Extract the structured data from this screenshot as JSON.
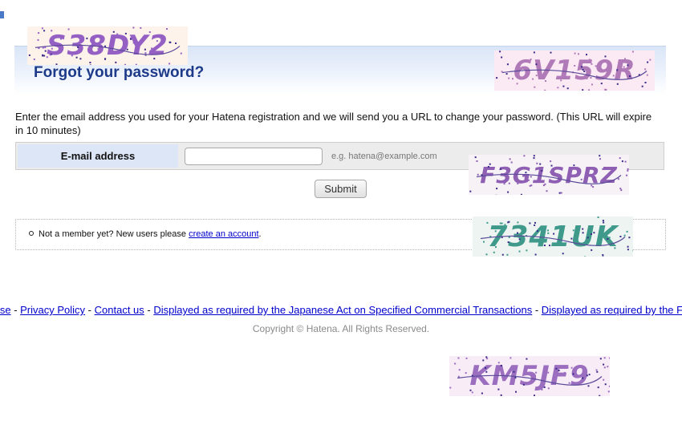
{
  "header": {
    "title": "Forgot your password?"
  },
  "intro_text": "Enter the email address you used for your Hatena registration and we will send you a URL to change your password. (This URL will expire in 10 minutes)",
  "form": {
    "email_label": "E-mail address",
    "email_value": "",
    "email_hint": "e.g. hatena@example.com",
    "submit_label": "Submit"
  },
  "member": {
    "text": "Not a member yet? New users please",
    "link_label": "create an account",
    "suffix": "."
  },
  "footer": {
    "links": [
      {
        "label": "of Use"
      },
      {
        "label": "Privacy Policy"
      },
      {
        "label": "Contact us"
      },
      {
        "label": "Displayed as required by the Japanese Act on Specified Commercial Transactions"
      },
      {
        "label": "Displayed as required by the Fund S"
      }
    ],
    "separator": " - ",
    "copyright": "Copyright © Hatena. All Rights Reserved."
  },
  "captchas": [
    {
      "text": "S38DY2",
      "color": "#9460c4",
      "bg": "#fdf3ea"
    },
    {
      "text": "6V159R",
      "color": "#b07ab8",
      "bg": "#fbeaf3"
    },
    {
      "text": "F3G1SPRZ",
      "color": "#8f5fb4",
      "bg": "#f6f2f6"
    },
    {
      "text": "7341UK",
      "color": "#3f9a8c",
      "bg": "#eef4f1"
    },
    {
      "text": "KM5JF9",
      "color": "#9b6ec0",
      "bg": "#f8ecf6"
    }
  ]
}
